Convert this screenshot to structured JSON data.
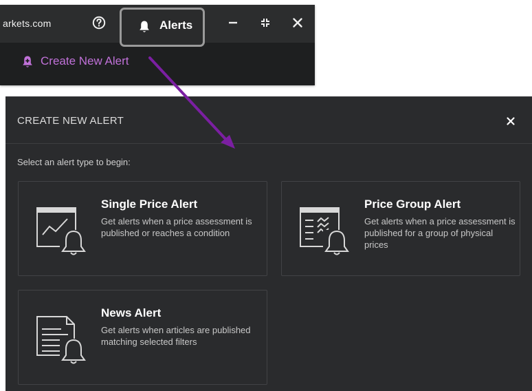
{
  "toolbar": {
    "site_text": "arkets.com",
    "help_icon": "question-circle-icon",
    "alerts_label": "Alerts",
    "alerts_icon": "bell-icon",
    "minimize_icon": "minimize-icon",
    "restore_icon": "collapse-icon",
    "close_icon": "close-icon"
  },
  "menu": {
    "create_label": "Create New Alert",
    "create_icon": "bell-plus-icon"
  },
  "panel": {
    "title": "CREATE NEW ALERT",
    "close_icon": "close-icon",
    "instruction": "Select an alert type to begin:",
    "cards": [
      {
        "title": "Single Price Alert",
        "description": "Get alerts when a price assessment is published or reaches a condition",
        "icon": "chart-bell-icon"
      },
      {
        "title": "Price Group Alert",
        "description": "Get alerts when a price assessment is published for a group of physical prices",
        "icon": "list-chart-bell-icon"
      },
      {
        "title": "News Alert",
        "description": "Get alerts when articles are published matching selected filters",
        "icon": "document-bell-icon"
      }
    ]
  },
  "colors": {
    "accent": "#c071d8",
    "arrow": "#7b1fa2",
    "panel_bg": "#2a2b2d",
    "toolbar_bg": "#2c2d2e"
  }
}
